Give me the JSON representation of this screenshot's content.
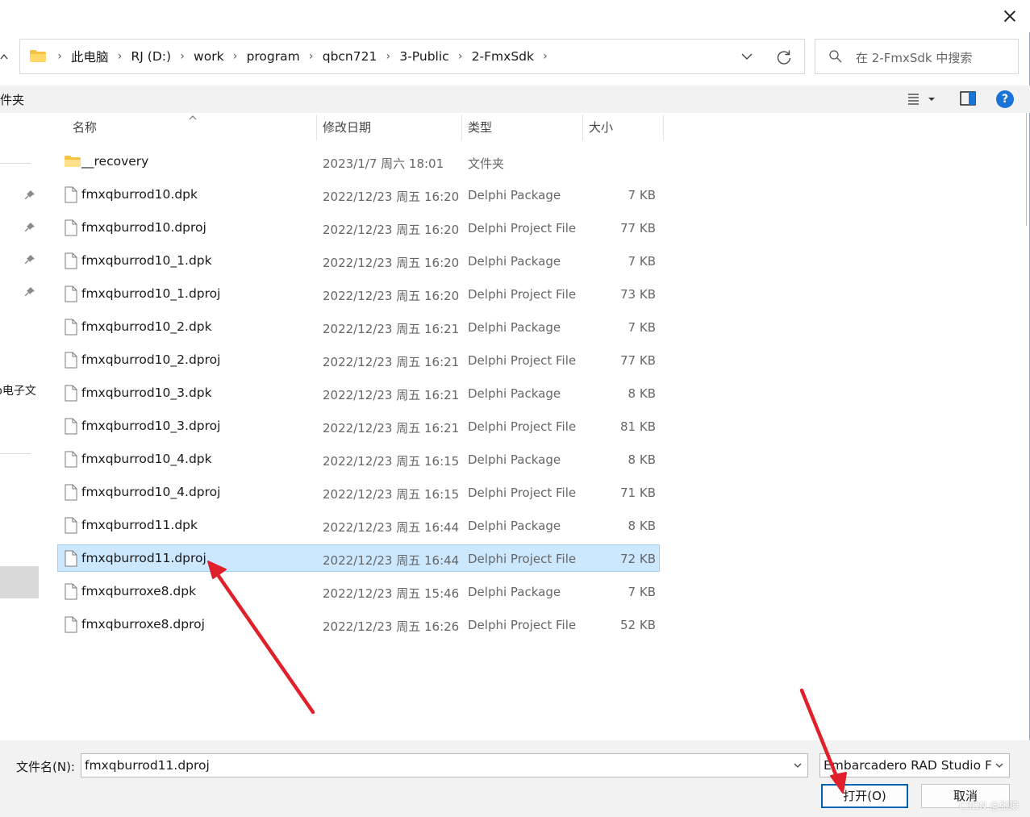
{
  "window": {
    "close_icon": "close-icon"
  },
  "address": {
    "root_icon": "folder-icon",
    "crumbs": [
      "此电脑",
      "RJ (D:)",
      "work",
      "program",
      "qbcn721",
      "3-Public",
      "2-FmxSdk"
    ]
  },
  "search": {
    "placeholder": "在 2-FmxSdk 中搜索"
  },
  "cmdbar": {
    "left_fragment": "件夹"
  },
  "navpane": {
    "fragment": "b电子文"
  },
  "columns": {
    "name": "名称",
    "date": "修改日期",
    "type": "类型",
    "size": "大小"
  },
  "files": [
    {
      "name": "__recovery",
      "date": "2023/1/7 周六 18:01",
      "type": "文件夹",
      "size": "",
      "kind": "folder"
    },
    {
      "name": "fmxqburrod10.dpk",
      "date": "2022/12/23 周五 16:20",
      "type": "Delphi Package",
      "size": "7 KB",
      "kind": "file"
    },
    {
      "name": "fmxqburrod10.dproj",
      "date": "2022/12/23 周五 16:20",
      "type": "Delphi Project File",
      "size": "77 KB",
      "kind": "file"
    },
    {
      "name": "fmxqburrod10_1.dpk",
      "date": "2022/12/23 周五 16:20",
      "type": "Delphi Package",
      "size": "7 KB",
      "kind": "file"
    },
    {
      "name": "fmxqburrod10_1.dproj",
      "date": "2022/12/23 周五 16:20",
      "type": "Delphi Project File",
      "size": "73 KB",
      "kind": "file"
    },
    {
      "name": "fmxqburrod10_2.dpk",
      "date": "2022/12/23 周五 16:21",
      "type": "Delphi Package",
      "size": "7 KB",
      "kind": "file"
    },
    {
      "name": "fmxqburrod10_2.dproj",
      "date": "2022/12/23 周五 16:21",
      "type": "Delphi Project File",
      "size": "77 KB",
      "kind": "file"
    },
    {
      "name": "fmxqburrod10_3.dpk",
      "date": "2022/12/23 周五 16:21",
      "type": "Delphi Package",
      "size": "8 KB",
      "kind": "file"
    },
    {
      "name": "fmxqburrod10_3.dproj",
      "date": "2022/12/23 周五 16:21",
      "type": "Delphi Project File",
      "size": "81 KB",
      "kind": "file"
    },
    {
      "name": "fmxqburrod10_4.dpk",
      "date": "2022/12/23 周五 16:15",
      "type": "Delphi Package",
      "size": "8 KB",
      "kind": "file"
    },
    {
      "name": "fmxqburrod10_4.dproj",
      "date": "2022/12/23 周五 16:15",
      "type": "Delphi Project File",
      "size": "71 KB",
      "kind": "file"
    },
    {
      "name": "fmxqburrod11.dpk",
      "date": "2022/12/23 周五 16:44",
      "type": "Delphi Package",
      "size": "8 KB",
      "kind": "file"
    },
    {
      "name": "fmxqburrod11.dproj",
      "date": "2022/12/23 周五 16:44",
      "type": "Delphi Project File",
      "size": "72 KB",
      "kind": "file",
      "selected": true
    },
    {
      "name": "fmxqburroxe8.dpk",
      "date": "2022/12/23 周五 15:46",
      "type": "Delphi Package",
      "size": "7 KB",
      "kind": "file"
    },
    {
      "name": "fmxqburroxe8.dproj",
      "date": "2022/12/23 周五 16:26",
      "type": "Delphi Project File",
      "size": "52 KB",
      "kind": "file"
    }
  ],
  "bottom": {
    "filename_label": "文件名(N):",
    "filename_value": "fmxqburrod11.dproj",
    "filetype_value": "Embarcadero RAD Studio File",
    "open_label": "打开(O)",
    "cancel_label": "取消",
    "watermark": "CSDN @张猿"
  },
  "colors": {
    "selection_bg": "#cce8ff",
    "selection_border": "#99d1ff",
    "accent": "#0063b1",
    "annotation_arrow": "#e0202a",
    "help_icon": "#1a73d6"
  }
}
